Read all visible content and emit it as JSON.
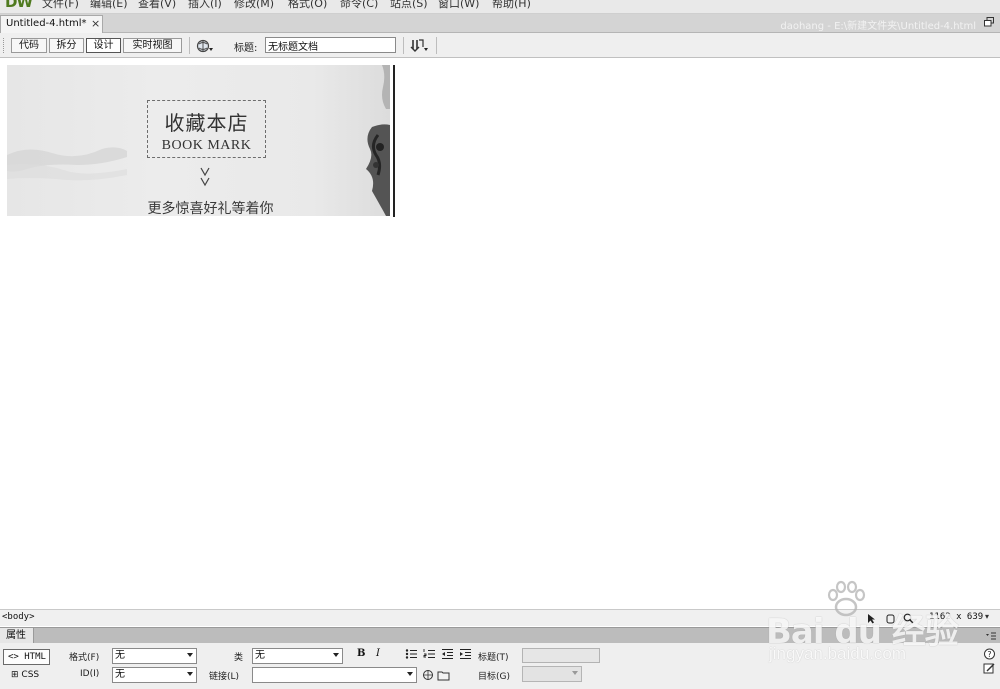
{
  "app": {
    "logo": "DW",
    "menu": [
      "文件(F)",
      "编辑(E)",
      "查看(V)",
      "插入(I)",
      "修改(M)",
      "格式(O)",
      "命令(C)",
      "站点(S)",
      "窗口(W)",
      "帮助(H)"
    ]
  },
  "tabs": {
    "document_tab": "Untitled-4.html*",
    "close_glyph": "×",
    "path": "daohang - E:\\新建文件夹\\Untitled-4.html"
  },
  "doc_toolbar": {
    "views": [
      "代码",
      "拆分",
      "设计",
      "实时视图"
    ],
    "active_view": "设计",
    "title_label": "标题:",
    "title_value": "无标题文档"
  },
  "canvas": {
    "banner": {
      "bookmark_cn": "收藏本店",
      "bookmark_en": "BOOK MARK",
      "more_gifts": "更多惊喜好礼等着你"
    }
  },
  "status": {
    "tag_selector": "<body>",
    "window_size": "1162 x 639",
    "size_caret": "▾"
  },
  "properties": {
    "tab_label": "属性",
    "html_button": "HTML",
    "css_button": "CSS",
    "format_label": "格式(F)",
    "format_value": "无",
    "id_label": "ID(I)",
    "id_value": "无",
    "class_label": "类",
    "class_value": "无",
    "link_label": "链接(L)",
    "link_value": "",
    "bold": "B",
    "italic": "I",
    "title_label": "标题(T)",
    "target_label": "目标(G)",
    "help_glyph": "?"
  },
  "watermark": {
    "brand": "Bai du 经验",
    "url": "jingyan.baidu.com"
  }
}
